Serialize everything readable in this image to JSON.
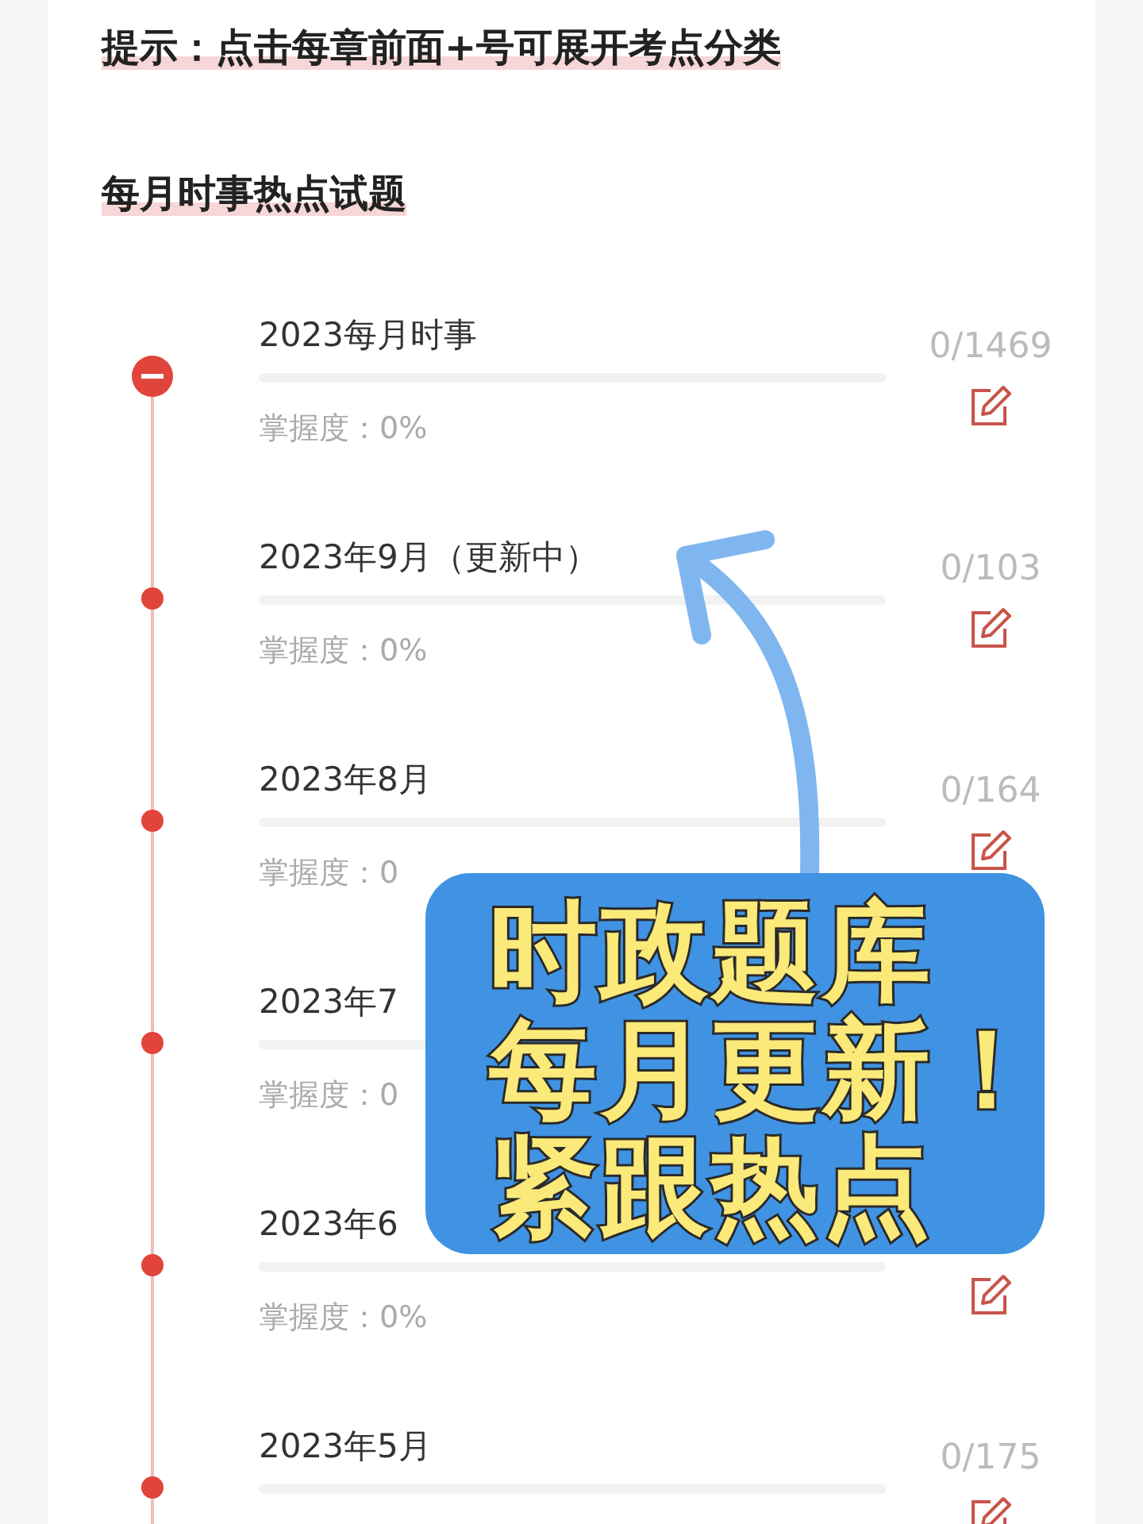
{
  "hint": "提示：点击每章前面+号可展开考点分类",
  "section_title": "每月时事热点试题",
  "rows": [
    {
      "kind": "group",
      "expanded": true,
      "title": "2023每月时事",
      "level": 0,
      "mastery": "掌握度：0%",
      "count": "0/1469",
      "edit": true
    },
    {
      "kind": "month",
      "title": "2023年9月（更新中）",
      "level": 0,
      "mastery": "掌握度：0%",
      "count": "0/103",
      "edit": true
    },
    {
      "kind": "month",
      "title": "2023年8月",
      "level": 0,
      "mastery": "掌握度：0",
      "count": "0/164",
      "edit": true
    },
    {
      "kind": "month",
      "title": "2023年7",
      "level": 0,
      "mastery": "掌握度：0",
      "edit": false
    },
    {
      "kind": "month",
      "title": "2023年6",
      "level": 0,
      "mastery": "掌握度：0%",
      "edit": true
    },
    {
      "kind": "month",
      "title": "2023年5月",
      "level": 0,
      "count": "0/175",
      "edit": true
    }
  ],
  "callout": {
    "lines": [
      "时政题库",
      "每月更新！",
      "紧跟热点"
    ]
  }
}
